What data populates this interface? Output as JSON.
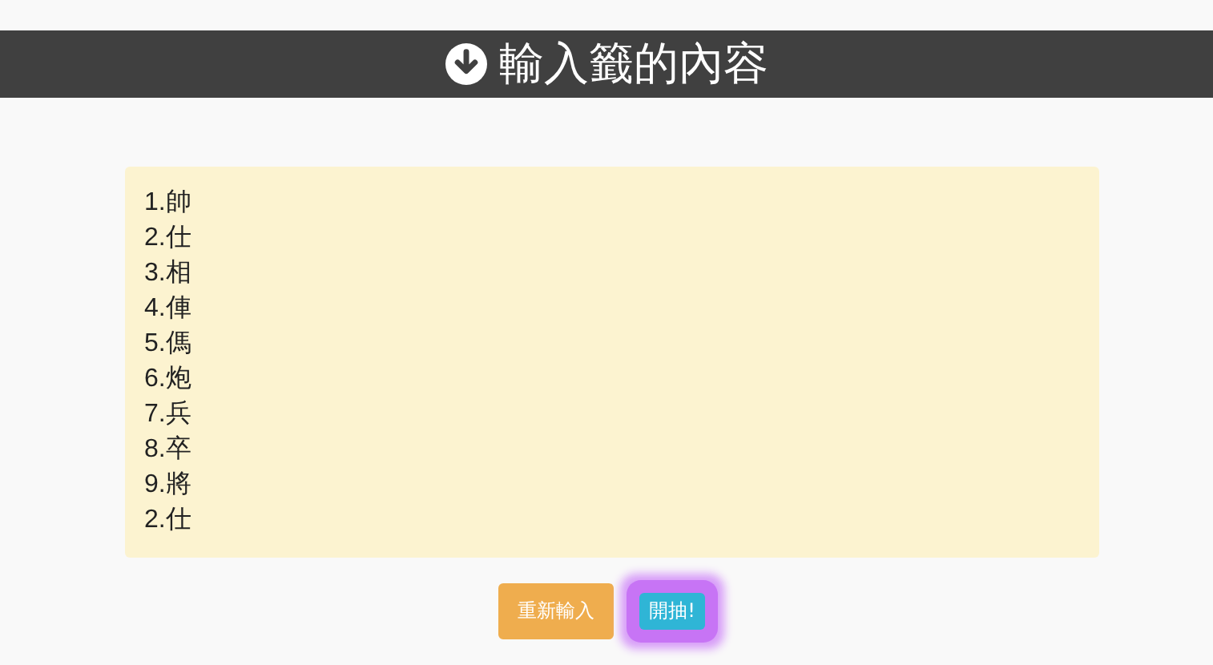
{
  "header": {
    "title": "輸入籤的內容"
  },
  "textarea": {
    "value": "1.帥\n2.仕\n3.相\n4.俥\n5.傌\n6.炮\n7.兵\n8.卒\n9.將\n2.仕"
  },
  "buttons": [
    {
      "label": "重新輸入",
      "kind": "reset"
    },
    {
      "label": "開抽!",
      "kind": "start",
      "focused": true
    }
  ]
}
